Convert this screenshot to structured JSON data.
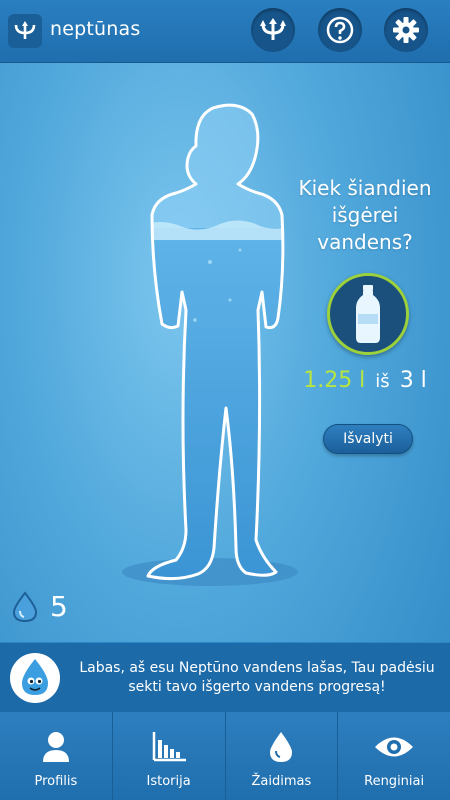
{
  "app": {
    "title": "neptūnas"
  },
  "header_icons": [
    "trident-icon",
    "help-icon",
    "settings-icon"
  ],
  "prompt": {
    "line1": "Kiek šiandien",
    "line2": "išgėrei",
    "line3": "vandens?"
  },
  "intake": {
    "current": "1.25 l",
    "separator": "iš",
    "goal": "3 l"
  },
  "clear_button": "Išvalyti",
  "drops": {
    "count": "5"
  },
  "message": "Labas, aš esu Neptūno vandens lašas, Tau padėsiu sekti tavo išgerto vandens progresą!",
  "nav": [
    {
      "label": "Profilis",
      "icon": "profile-icon"
    },
    {
      "label": "Istorija",
      "icon": "bar-chart-icon"
    },
    {
      "label": "Žaidimas",
      "icon": "drop-icon"
    },
    {
      "label": "Renginiai",
      "icon": "eye-icon"
    }
  ],
  "colors": {
    "accent": "#b8e53f",
    "header": "#1f6eae",
    "background": "#4ea6da"
  }
}
